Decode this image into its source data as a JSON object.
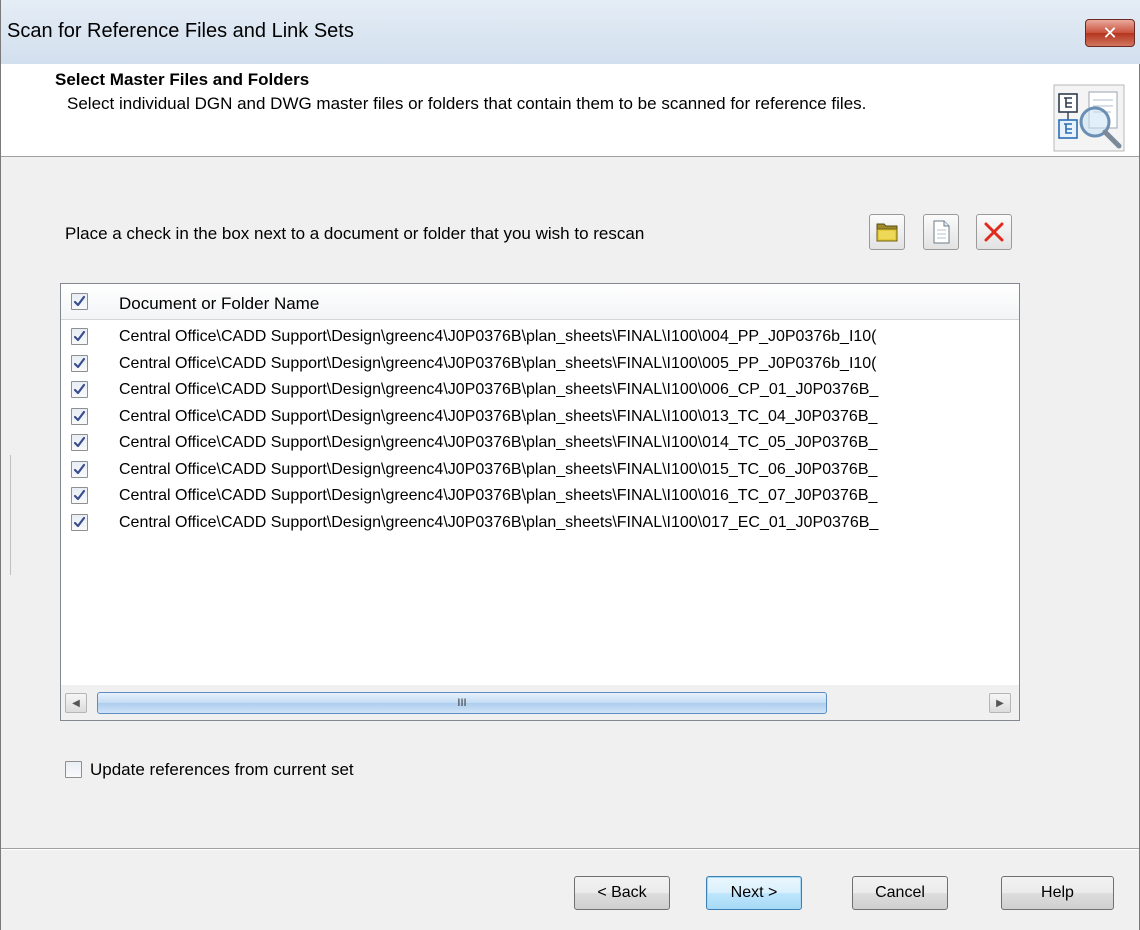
{
  "window": {
    "title": "Scan for Reference Files and Link Sets",
    "close_glyph": "✕"
  },
  "header": {
    "heading": "Select Master Files and Folders",
    "subheading": "Select individual DGN and DWG master files or folders that contain them to be scanned for reference files.",
    "icon": "reference-scan-icon"
  },
  "instruction": "Place a check in the box next to a document or folder that you wish to rescan",
  "toolbar": {
    "icons": [
      "add-folder-icon",
      "add-document-icon",
      "remove-icon"
    ]
  },
  "list": {
    "header_checked": true,
    "column_title": "Document or Folder Name",
    "rows": [
      {
        "checked": true,
        "path": "Central Office\\CADD Support\\Design\\greenc4\\J0P0376B\\plan_sheets\\FINAL\\I100\\004_PP_J0P0376b_I10("
      },
      {
        "checked": true,
        "path": "Central Office\\CADD Support\\Design\\greenc4\\J0P0376B\\plan_sheets\\FINAL\\I100\\005_PP_J0P0376b_I10("
      },
      {
        "checked": true,
        "path": "Central Office\\CADD Support\\Design\\greenc4\\J0P0376B\\plan_sheets\\FINAL\\I100\\006_CP_01_J0P0376B_"
      },
      {
        "checked": true,
        "path": "Central Office\\CADD Support\\Design\\greenc4\\J0P0376B\\plan_sheets\\FINAL\\I100\\013_TC_04_J0P0376B_"
      },
      {
        "checked": true,
        "path": "Central Office\\CADD Support\\Design\\greenc4\\J0P0376B\\plan_sheets\\FINAL\\I100\\014_TC_05_J0P0376B_"
      },
      {
        "checked": true,
        "path": "Central Office\\CADD Support\\Design\\greenc4\\J0P0376B\\plan_sheets\\FINAL\\I100\\015_TC_06_J0P0376B_"
      },
      {
        "checked": true,
        "path": "Central Office\\CADD Support\\Design\\greenc4\\J0P0376B\\plan_sheets\\FINAL\\I100\\016_TC_07_J0P0376B_"
      },
      {
        "checked": true,
        "path": "Central Office\\CADD Support\\Design\\greenc4\\J0P0376B\\plan_sheets\\FINAL\\I100\\017_EC_01_J0P0376B_"
      }
    ],
    "scroll_thumb_glyph": "III",
    "scroll_left_glyph": "◀",
    "scroll_right_glyph": "▶"
  },
  "update_option": {
    "checked": false,
    "label": "Update references from current set"
  },
  "buttons": {
    "back": "< Back",
    "next": "Next >",
    "cancel": "Cancel",
    "help": "Help"
  }
}
